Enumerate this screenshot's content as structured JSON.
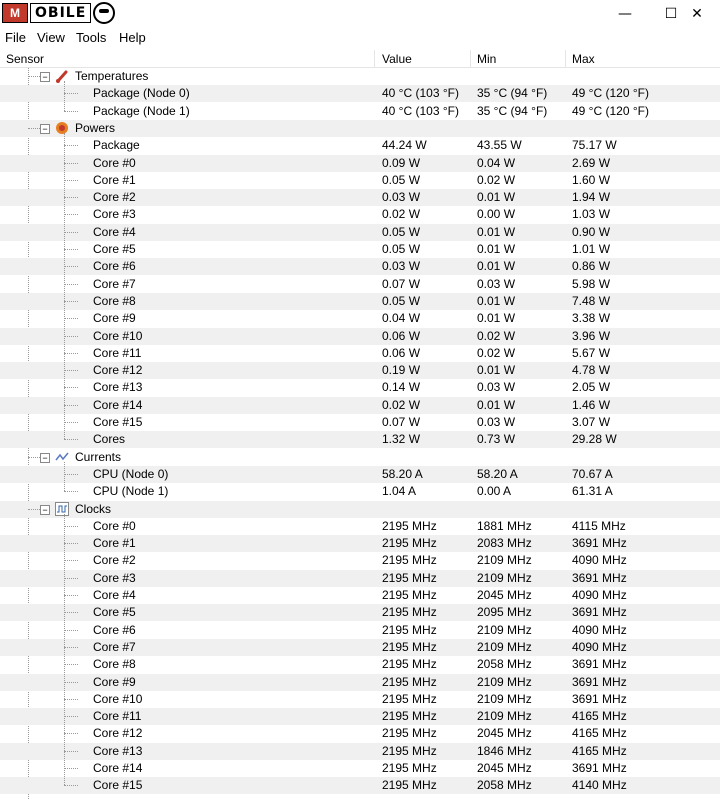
{
  "window": {
    "logo_text": "M●BILE"
  },
  "window_controls": {
    "minimize": "—",
    "maximize": "☐",
    "close": "✕"
  },
  "menu": [
    "File",
    "View",
    "Tools",
    "Help"
  ],
  "columns": [
    "Sensor",
    "Value",
    "Min",
    "Max"
  ],
  "groups": [
    {
      "name": "Temperatures",
      "icon": "thermometer-icon",
      "rows": [
        {
          "label": "Package (Node 0)",
          "value": "40 °C  (103 °F)",
          "min": "35 °C  (94 °F)",
          "max": "49 °C  (120 °F)"
        },
        {
          "label": "Package (Node 1)",
          "value": "40 °C  (103 °F)",
          "min": "35 °C  (94 °F)",
          "max": "49 °C  (120 °F)"
        }
      ]
    },
    {
      "name": "Powers",
      "icon": "power-icon",
      "rows": [
        {
          "label": "Package",
          "value": "44.24 W",
          "min": "43.55 W",
          "max": "75.17 W"
        },
        {
          "label": "Core #0",
          "value": "0.09 W",
          "min": "0.04 W",
          "max": "2.69 W"
        },
        {
          "label": "Core #1",
          "value": "0.05 W",
          "min": "0.02 W",
          "max": "1.60 W"
        },
        {
          "label": "Core #2",
          "value": "0.03 W",
          "min": "0.01 W",
          "max": "1.94 W"
        },
        {
          "label": "Core #3",
          "value": "0.02 W",
          "min": "0.00 W",
          "max": "1.03 W"
        },
        {
          "label": "Core #4",
          "value": "0.05 W",
          "min": "0.01 W",
          "max": "0.90 W"
        },
        {
          "label": "Core #5",
          "value": "0.05 W",
          "min": "0.01 W",
          "max": "1.01 W"
        },
        {
          "label": "Core #6",
          "value": "0.03 W",
          "min": "0.01 W",
          "max": "0.86 W"
        },
        {
          "label": "Core #7",
          "value": "0.07 W",
          "min": "0.03 W",
          "max": "5.98 W"
        },
        {
          "label": "Core #8",
          "value": "0.05 W",
          "min": "0.01 W",
          "max": "7.48 W"
        },
        {
          "label": "Core #9",
          "value": "0.04 W",
          "min": "0.01 W",
          "max": "3.38 W"
        },
        {
          "label": "Core #10",
          "value": "0.06 W",
          "min": "0.02 W",
          "max": "3.96 W"
        },
        {
          "label": "Core #11",
          "value": "0.06 W",
          "min": "0.02 W",
          "max": "5.67 W"
        },
        {
          "label": "Core #12",
          "value": "0.19 W",
          "min": "0.01 W",
          "max": "4.78 W"
        },
        {
          "label": "Core #13",
          "value": "0.14 W",
          "min": "0.03 W",
          "max": "2.05 W"
        },
        {
          "label": "Core #14",
          "value": "0.02 W",
          "min": "0.01 W",
          "max": "1.46 W"
        },
        {
          "label": "Core #15",
          "value": "0.07 W",
          "min": "0.03 W",
          "max": "3.07 W"
        },
        {
          "label": "Cores",
          "value": "1.32 W",
          "min": "0.73 W",
          "max": "29.28 W"
        }
      ]
    },
    {
      "name": "Currents",
      "icon": "current-icon",
      "rows": [
        {
          "label": "CPU (Node 0)",
          "value": "58.20 A",
          "min": "58.20 A",
          "max": "70.67 A"
        },
        {
          "label": "CPU (Node 1)",
          "value": "1.04 A",
          "min": "0.00 A",
          "max": "61.31 A"
        }
      ]
    },
    {
      "name": "Clocks",
      "icon": "clock-wave-icon",
      "rows": [
        {
          "label": "Core #0",
          "value": "2195 MHz",
          "min": "1881 MHz",
          "max": "4115 MHz"
        },
        {
          "label": "Core #1",
          "value": "2195 MHz",
          "min": "2083 MHz",
          "max": "3691 MHz"
        },
        {
          "label": "Core #2",
          "value": "2195 MHz",
          "min": "2109 MHz",
          "max": "4090 MHz"
        },
        {
          "label": "Core #3",
          "value": "2195 MHz",
          "min": "2109 MHz",
          "max": "3691 MHz"
        },
        {
          "label": "Core #4",
          "value": "2195 MHz",
          "min": "2045 MHz",
          "max": "4090 MHz"
        },
        {
          "label": "Core #5",
          "value": "2195 MHz",
          "min": "2095 MHz",
          "max": "3691 MHz"
        },
        {
          "label": "Core #6",
          "value": "2195 MHz",
          "min": "2109 MHz",
          "max": "4090 MHz"
        },
        {
          "label": "Core #7",
          "value": "2195 MHz",
          "min": "2109 MHz",
          "max": "4090 MHz"
        },
        {
          "label": "Core #8",
          "value": "2195 MHz",
          "min": "2058 MHz",
          "max": "3691 MHz"
        },
        {
          "label": "Core #9",
          "value": "2195 MHz",
          "min": "2109 MHz",
          "max": "3691 MHz"
        },
        {
          "label": "Core #10",
          "value": "2195 MHz",
          "min": "2109 MHz",
          "max": "3691 MHz"
        },
        {
          "label": "Core #11",
          "value": "2195 MHz",
          "min": "2109 MHz",
          "max": "4165 MHz"
        },
        {
          "label": "Core #12",
          "value": "2195 MHz",
          "min": "2045 MHz",
          "max": "4165 MHz"
        },
        {
          "label": "Core #13",
          "value": "2195 MHz",
          "min": "1846 MHz",
          "max": "4165 MHz"
        },
        {
          "label": "Core #14",
          "value": "2195 MHz",
          "min": "2045 MHz",
          "max": "3691 MHz"
        },
        {
          "label": "Core #15",
          "value": "2195 MHz",
          "min": "2058 MHz",
          "max": "4140 MHz"
        }
      ]
    }
  ]
}
